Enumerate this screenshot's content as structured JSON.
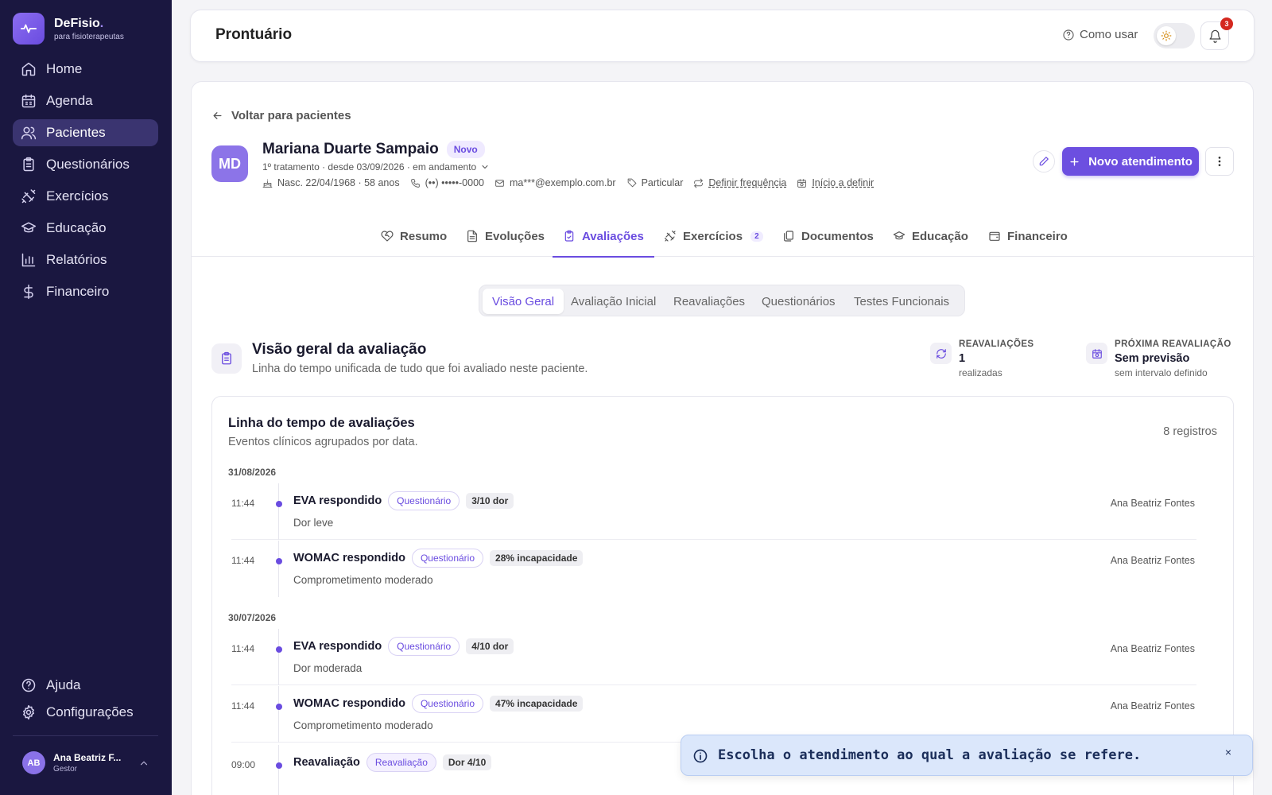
{
  "brand": {
    "name": "DeFisio",
    "dot": ".",
    "tagline": "para fisioterapeutas"
  },
  "nav": [
    {
      "label": "Home",
      "icon": "home-icon"
    },
    {
      "label": "Agenda",
      "icon": "calendar-icon"
    },
    {
      "label": "Pacientes",
      "icon": "users-icon",
      "active": true
    },
    {
      "label": "Questionários",
      "icon": "clipboard-icon"
    },
    {
      "label": "Exercícios",
      "icon": "dumbbell-icon"
    },
    {
      "label": "Educação",
      "icon": "graduation-cap-icon"
    },
    {
      "label": "Relatórios",
      "icon": "bar-chart-icon"
    },
    {
      "label": "Financeiro",
      "icon": "dollar-icon"
    }
  ],
  "nav_bottom": [
    {
      "label": "Ajuda",
      "icon": "help-circle-icon"
    },
    {
      "label": "Configurações",
      "icon": "gear-icon"
    }
  ],
  "user": {
    "initials": "AB",
    "name": "Ana Beatriz F...",
    "role": "Gestor"
  },
  "topbar": {
    "title": "Prontuário",
    "help": "Como usar",
    "notifications": "3"
  },
  "patient": {
    "back": "Voltar para pacientes",
    "initials": "MD",
    "name": "Mariana Duarte Sampaio",
    "badge": "Novo",
    "treatment": "1º tratamento · desde 03/09/2026 · em andamento",
    "birth": "Nasc. 22/04/1968 · 58 anos",
    "phone": "(••) •••••-0000",
    "email": "ma***@exemplo.com.br",
    "plan": "Particular",
    "frequency": "Definir frequência",
    "start": "Início a definir",
    "new_button": "Novo atendimento"
  },
  "tabs": [
    {
      "label": "Resumo",
      "icon": "heart-handshake-icon"
    },
    {
      "label": "Evoluções",
      "icon": "file-text-icon"
    },
    {
      "label": "Avaliações",
      "icon": "clipboard-check-icon",
      "active": true
    },
    {
      "label": "Exercícios",
      "icon": "dumbbell-icon",
      "count": "2"
    },
    {
      "label": "Documentos",
      "icon": "files-icon"
    },
    {
      "label": "Educação",
      "icon": "graduation-cap-icon"
    },
    {
      "label": "Financeiro",
      "icon": "wallet-icon"
    }
  ],
  "subtabs": [
    "Visão Geral",
    "Avaliação Inicial",
    "Reavaliações",
    "Questionários",
    "Testes Funcionais"
  ],
  "overview": {
    "title": "Visão geral da avaliação",
    "subtitle": "Linha do tempo unificada de tudo que foi avaliado neste paciente.",
    "stats": [
      {
        "label": "REAVALIAÇÕES",
        "value": "1",
        "note": "realizadas"
      },
      {
        "label": "PRÓXIMA REAVALIAÇÃO",
        "value": "Sem previsão",
        "note": "sem intervalo definido"
      }
    ]
  },
  "timeline": {
    "title": "Linha do tempo de avaliações",
    "subtitle": "Eventos clínicos agrupados por data.",
    "count": "8 registros",
    "groups": [
      {
        "date": "31/08/2026",
        "events": [
          {
            "time": "11:44",
            "title": "EVA respondido",
            "chip": "Questionário",
            "value": "3/10 dor",
            "desc": "Dor leve",
            "author": "Ana Beatriz Fontes"
          },
          {
            "time": "11:44",
            "title": "WOMAC respondido",
            "chip": "Questionário",
            "value": "28% incapacidade",
            "desc": "Comprometimento moderado",
            "author": "Ana Beatriz Fontes"
          }
        ]
      },
      {
        "date": "30/07/2026",
        "events": [
          {
            "time": "11:44",
            "title": "EVA respondido",
            "chip": "Questionário",
            "value": "4/10 dor",
            "desc": "Dor moderada",
            "author": "Ana Beatriz Fontes"
          },
          {
            "time": "11:44",
            "title": "WOMAC respondido",
            "chip": "Questionário",
            "value": "47% incapacidade",
            "desc": "Comprometimento moderado",
            "author": "Ana Beatriz Fontes"
          },
          {
            "time": "09:00",
            "title": "Reavaliação",
            "chip": "Reavaliação",
            "value": "Dor 4/10",
            "desc": "",
            "author": ""
          }
        ]
      }
    ]
  },
  "toast": {
    "message": "Escolha o atendimento ao qual a avaliação se refere.",
    "close": "×"
  },
  "colors": {
    "sidebar": "#1a1740",
    "accent": "#6c4fe0",
    "toast_bg": "#dbe7fb"
  }
}
